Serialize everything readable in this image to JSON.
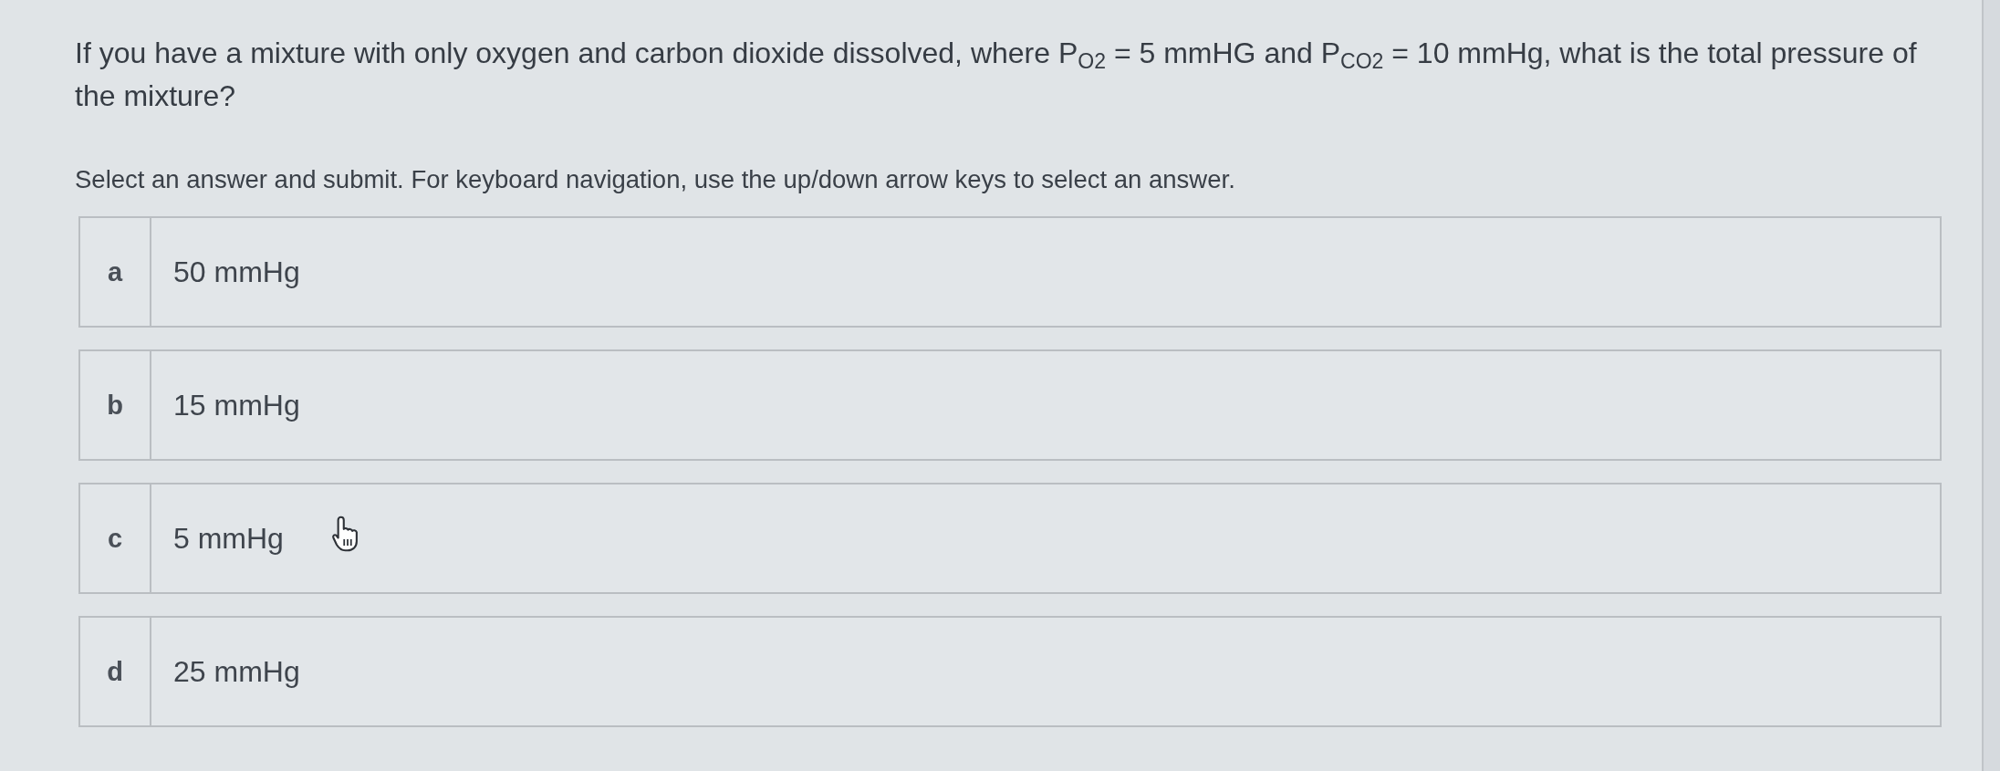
{
  "question": {
    "text": "If you have a mixture with only oxygen and carbon dioxide dissolved, where P$_{O2}$ = 5 mmHG and P$_{CO2}$ = 10 mmHg, what is the total pressure of the mixture?"
  },
  "instructions": "Select an answer and submit. For keyboard navigation, use the up/down arrow keys to select an answer.",
  "options": [
    {
      "letter": "a",
      "text": "50 mmHg",
      "selected": false,
      "hovered": false
    },
    {
      "letter": "b",
      "text": "15 mmHg",
      "selected": false,
      "hovered": false
    },
    {
      "letter": "c",
      "text": "5 mmHg",
      "selected": false,
      "hovered": true
    },
    {
      "letter": "d",
      "text": "25 mmHg",
      "selected": false,
      "hovered": false
    }
  ]
}
